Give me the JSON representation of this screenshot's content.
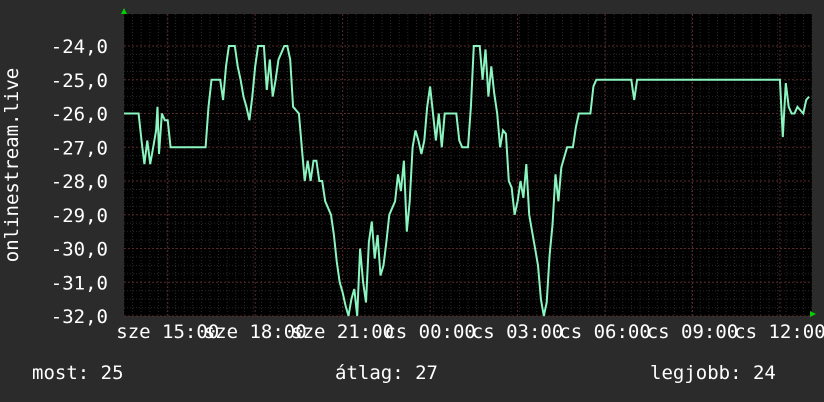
{
  "chart_data": {
    "type": "line",
    "ylabel": "onlinestream.live",
    "ylim": [
      -32,
      -24
    ],
    "yticks": [
      -24,
      -25,
      -26,
      -27,
      -28,
      -29,
      -30,
      -31,
      -32
    ],
    "ytick_labels": [
      "-24,0",
      "-25,0",
      "-26,0",
      "-27,0",
      "-28,0",
      "-29,0",
      "-30,0",
      "-31,0",
      "-32,0"
    ],
    "xlim": [
      0,
      23.6
    ],
    "xticks": [
      1.5,
      4.5,
      7.5,
      10.5,
      13.5,
      16.5,
      19.5,
      22.5
    ],
    "xtick_labels": [
      "sze 15:00",
      "sze 18:00",
      "sze 21:00",
      "cs 00:00",
      "cs 03:00",
      "cs 06:00",
      "cs 09:00",
      "cs 12:00"
    ],
    "grid": true,
    "colors": {
      "line": "#8bf5c0",
      "background": "#2b2b2b",
      "plot": "#000000",
      "grid": "#5a2a2a",
      "axis_arrow": "#00d000"
    },
    "series": [
      {
        "points": [
          [
            0.0,
            -26
          ],
          [
            0.5,
            -26
          ],
          [
            0.6,
            -26.8
          ],
          [
            0.7,
            -27.5
          ],
          [
            0.8,
            -26.8
          ],
          [
            0.9,
            -27.5
          ],
          [
            1.0,
            -27
          ],
          [
            1.1,
            -26.5
          ],
          [
            1.15,
            -25.8
          ],
          [
            1.2,
            -27.2
          ],
          [
            1.3,
            -26
          ],
          [
            1.4,
            -26.2
          ],
          [
            1.5,
            -26.2
          ],
          [
            1.6,
            -27
          ],
          [
            2.0,
            -27
          ],
          [
            2.5,
            -27
          ],
          [
            2.8,
            -27
          ],
          [
            2.9,
            -25.8
          ],
          [
            3.0,
            -25
          ],
          [
            3.3,
            -25
          ],
          [
            3.4,
            -25.6
          ],
          [
            3.5,
            -24.6
          ],
          [
            3.6,
            -24
          ],
          [
            3.8,
            -24
          ],
          [
            3.9,
            -24.6
          ],
          [
            4.0,
            -25
          ],
          [
            4.1,
            -25.5
          ],
          [
            4.2,
            -25.8
          ],
          [
            4.3,
            -26.2
          ],
          [
            4.4,
            -25.5
          ],
          [
            4.5,
            -24.6
          ],
          [
            4.6,
            -24
          ],
          [
            4.8,
            -24
          ],
          [
            4.9,
            -25.3
          ],
          [
            5.0,
            -24.4
          ],
          [
            5.1,
            -25.5
          ],
          [
            5.2,
            -25
          ],
          [
            5.3,
            -24.4
          ],
          [
            5.4,
            -24.2
          ],
          [
            5.5,
            -24
          ],
          [
            5.6,
            -24
          ],
          [
            5.7,
            -24.4
          ],
          [
            5.8,
            -25.8
          ],
          [
            6.0,
            -26
          ],
          [
            6.1,
            -27
          ],
          [
            6.2,
            -28
          ],
          [
            6.3,
            -27.4
          ],
          [
            6.4,
            -28
          ],
          [
            6.5,
            -27.4
          ],
          [
            6.6,
            -27.4
          ],
          [
            6.7,
            -28
          ],
          [
            6.8,
            -28
          ],
          [
            6.9,
            -28.6
          ],
          [
            7.0,
            -28.8
          ],
          [
            7.1,
            -29
          ],
          [
            7.2,
            -29.6
          ],
          [
            7.3,
            -30.4
          ],
          [
            7.4,
            -31
          ],
          [
            7.5,
            -31.3
          ],
          [
            7.6,
            -31.7
          ],
          [
            7.7,
            -32
          ],
          [
            7.8,
            -31.5
          ],
          [
            7.9,
            -31.2
          ],
          [
            8.0,
            -32
          ],
          [
            8.1,
            -30
          ],
          [
            8.2,
            -31
          ],
          [
            8.3,
            -31.6
          ],
          [
            8.4,
            -29.8
          ],
          [
            8.5,
            -29.2
          ],
          [
            8.6,
            -30.3
          ],
          [
            8.7,
            -29.6
          ],
          [
            8.8,
            -30.8
          ],
          [
            8.9,
            -30.5
          ],
          [
            9.0,
            -29.8
          ],
          [
            9.1,
            -29
          ],
          [
            9.3,
            -28.6
          ],
          [
            9.4,
            -27.8
          ],
          [
            9.5,
            -28.3
          ],
          [
            9.6,
            -27.4
          ],
          [
            9.7,
            -29.5
          ],
          [
            9.8,
            -28.6
          ],
          [
            9.9,
            -27
          ],
          [
            10.0,
            -26.5
          ],
          [
            10.1,
            -26.8
          ],
          [
            10.2,
            -27.2
          ],
          [
            10.3,
            -26.8
          ],
          [
            10.4,
            -25.8
          ],
          [
            10.5,
            -25.2
          ],
          [
            10.6,
            -26
          ],
          [
            10.7,
            -26.8
          ],
          [
            10.8,
            -26
          ],
          [
            10.9,
            -27
          ],
          [
            11.0,
            -26
          ],
          [
            11.2,
            -26
          ],
          [
            11.4,
            -26
          ],
          [
            11.5,
            -26.8
          ],
          [
            11.6,
            -27
          ],
          [
            11.8,
            -27
          ],
          [
            11.9,
            -25.8
          ],
          [
            12.0,
            -24
          ],
          [
            12.2,
            -24
          ],
          [
            12.3,
            -25
          ],
          [
            12.4,
            -24.1
          ],
          [
            12.5,
            -25.5
          ],
          [
            12.6,
            -24.6
          ],
          [
            12.7,
            -25.4
          ],
          [
            12.8,
            -26
          ],
          [
            12.9,
            -27
          ],
          [
            13.0,
            -26.5
          ],
          [
            13.1,
            -26.6
          ],
          [
            13.2,
            -28
          ],
          [
            13.3,
            -28.2
          ],
          [
            13.4,
            -29
          ],
          [
            13.5,
            -28.6
          ],
          [
            13.6,
            -28
          ],
          [
            13.7,
            -28.5
          ],
          [
            13.8,
            -27.5
          ],
          [
            13.9,
            -29
          ],
          [
            14.0,
            -29.5
          ],
          [
            14.1,
            -30
          ],
          [
            14.2,
            -30.5
          ],
          [
            14.3,
            -31.5
          ],
          [
            14.4,
            -32
          ],
          [
            14.5,
            -31.6
          ],
          [
            14.6,
            -30.2
          ],
          [
            14.7,
            -29.3
          ],
          [
            14.8,
            -27.8
          ],
          [
            14.9,
            -28.6
          ],
          [
            15.0,
            -27.6
          ],
          [
            15.1,
            -27.3
          ],
          [
            15.2,
            -27
          ],
          [
            15.4,
            -27
          ],
          [
            15.5,
            -26.4
          ],
          [
            15.6,
            -26
          ],
          [
            16.0,
            -26
          ],
          [
            16.1,
            -25.2
          ],
          [
            16.2,
            -25
          ],
          [
            17.0,
            -25
          ],
          [
            17.4,
            -25
          ],
          [
            17.5,
            -25.6
          ],
          [
            17.6,
            -25
          ],
          [
            20.0,
            -25
          ],
          [
            22.0,
            -25
          ],
          [
            22.5,
            -25
          ],
          [
            22.6,
            -26.7
          ],
          [
            22.7,
            -25.1
          ],
          [
            22.8,
            -25.8
          ],
          [
            22.9,
            -26
          ],
          [
            23.0,
            -26
          ],
          [
            23.1,
            -25.8
          ],
          [
            23.2,
            -25.9
          ],
          [
            23.3,
            -26
          ],
          [
            23.4,
            -25.6
          ],
          [
            23.5,
            -25.5
          ]
        ]
      }
    ],
    "legend": {
      "current_label": "most: 25",
      "average_label": "átlag: 27",
      "best_label": "legjobb: 24"
    }
  }
}
